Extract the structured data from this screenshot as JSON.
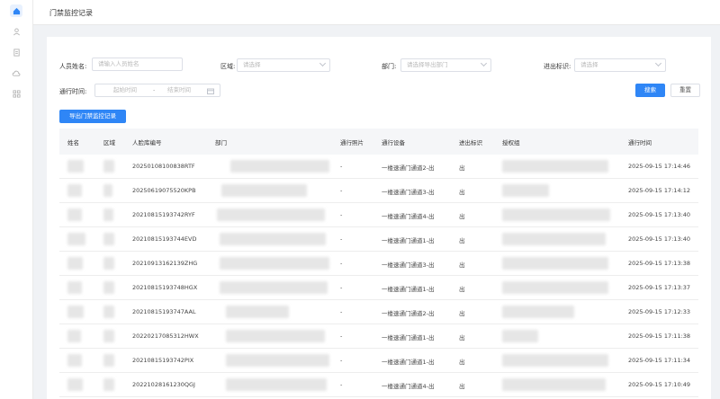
{
  "header": {
    "title": "门禁监控记录"
  },
  "sidebar": {
    "icons": [
      "home-icon",
      "user-icon",
      "document-icon",
      "cloud-icon",
      "grid-icon"
    ]
  },
  "filters": {
    "name_label": "人员姓名:",
    "name_placeholder": "请输入人员姓名",
    "area_label": "区域:",
    "area_placeholder": "请选择",
    "dept_label": "部门:",
    "dept_placeholder": "请选择导出部门",
    "direction_label": "进出标识:",
    "direction_placeholder": "请选择",
    "time_label": "通行时间:",
    "start_placeholder": "起始时间",
    "range_sep": "-",
    "end_placeholder": "结束时间"
  },
  "actions": {
    "search": "搜索",
    "reset": "重置",
    "export": "导出门禁监控记录"
  },
  "table": {
    "columns": [
      "姓名",
      "区域",
      "人脸库编号",
      "部门",
      "通行照片",
      "通行设备",
      "进出标识",
      "授权组",
      "通行时间"
    ],
    "rows": [
      {
        "face_id": "20250108100838RTF",
        "photo": "-",
        "device": "一楼速通门通道2-出",
        "direction": "出",
        "time": "2025-09-15 17:14:46"
      },
      {
        "face_id": "20250619075520KPB",
        "photo": "-",
        "device": "一楼速通门通道3-出",
        "direction": "出",
        "time": "2025-09-15 17:14:12"
      },
      {
        "face_id": "20210815193742RYF",
        "photo": "-",
        "device": "一楼速通门通道4-出",
        "direction": "出",
        "time": "2025-09-15 17:13:40"
      },
      {
        "face_id": "20210815193744EVD",
        "photo": "-",
        "device": "一楼速通门通道1-出",
        "direction": "出",
        "time": "2025-09-15 17:13:40"
      },
      {
        "face_id": "20210913162139ZHG",
        "photo": "-",
        "device": "一楼速通门通道3-出",
        "direction": "出",
        "time": "2025-09-15 17:13:38"
      },
      {
        "face_id": "20210815193748HGX",
        "photo": "-",
        "device": "一楼速通门通道1-出",
        "direction": "出",
        "time": "2025-09-15 17:13:37"
      },
      {
        "face_id": "20210815193747AAL",
        "photo": "-",
        "device": "一楼速通门通道2-出",
        "direction": "出",
        "time": "2025-09-15 17:12:33"
      },
      {
        "face_id": "20220217085312HWX",
        "photo": "-",
        "device": "一楼速通门通道1-出",
        "direction": "出",
        "time": "2025-09-15 17:11:38"
      },
      {
        "face_id": "20210815193742PIX",
        "photo": "-",
        "device": "一楼速通门通道1-出",
        "direction": "出",
        "time": "2025-09-15 17:11:34"
      },
      {
        "face_id": "20221028161230QGJ",
        "photo": "-",
        "device": "一楼速通门通道4-出",
        "direction": "出",
        "time": "2025-09-15 17:10:49"
      }
    ]
  }
}
